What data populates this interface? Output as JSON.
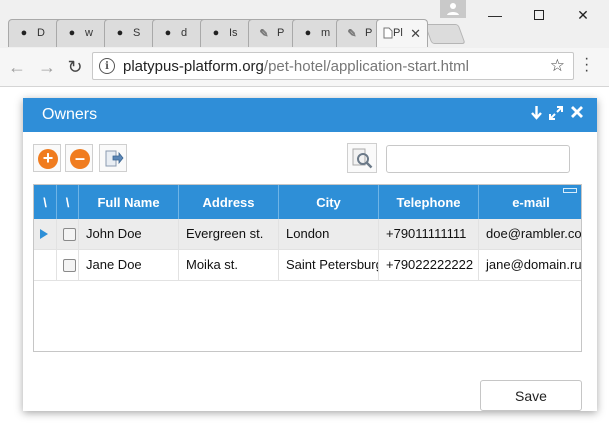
{
  "browser": {
    "tabs": [
      {
        "icon": "github-icon",
        "title": "D"
      },
      {
        "icon": "github-icon",
        "title": "w"
      },
      {
        "icon": "github-icon",
        "title": "S"
      },
      {
        "icon": "github-icon",
        "title": "d"
      },
      {
        "icon": "github-icon",
        "title": "Is"
      },
      {
        "icon": "platypus-icon",
        "title": "P"
      },
      {
        "icon": "github-icon",
        "title": "m"
      },
      {
        "icon": "platypus-icon",
        "title": "P"
      },
      {
        "icon": "page-icon",
        "title": "Pl"
      }
    ],
    "url_host": "platypus-platform.org",
    "url_path": "/pet-hotel/application-start.html"
  },
  "dialog": {
    "title": "Owners",
    "search": {
      "value": "",
      "placeholder": ""
    },
    "columns": [
      "\\",
      "\\",
      "Full Name",
      "Address",
      "City",
      "Telephone",
      "e-mail"
    ],
    "rows": [
      {
        "full_name": "John Doe",
        "address": "Evergreen st.",
        "city": "London",
        "telephone": "+79011111111",
        "email": "doe@rambler.com",
        "selected": true
      },
      {
        "full_name": "Jane Doe",
        "address": "Moika st.",
        "city": "Saint Petersburg",
        "telephone": "+79022222222",
        "email": "jane@domain.ru",
        "selected": false
      }
    ],
    "save_label": "Save"
  },
  "colors": {
    "accent": "#2f8ed8",
    "add_orange": "#f07c1f"
  }
}
